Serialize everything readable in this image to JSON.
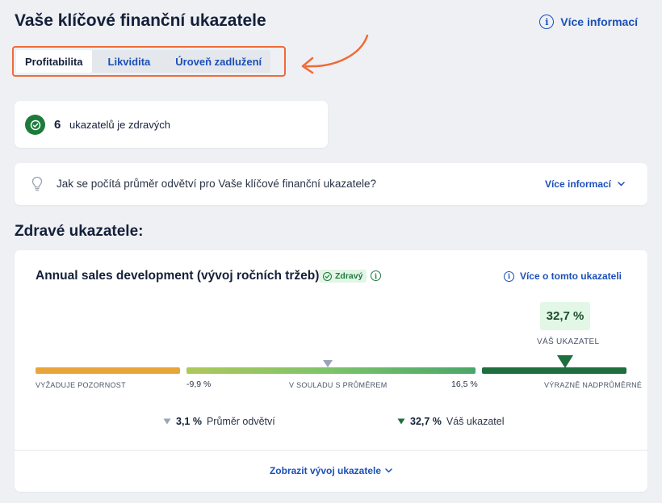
{
  "page_title": "Vaše klíčové finanční ukazatele",
  "more_info_top": "Více informací",
  "tabs": [
    {
      "label": "Profitabilita",
      "active": true
    },
    {
      "label": "Likvidita",
      "active": false
    },
    {
      "label": "Úroveň zadlužení",
      "active": false
    }
  ],
  "healthy": {
    "count": "6",
    "label": "ukazatelů je zdravých"
  },
  "faq": {
    "question": "Jak se počítá průměr odvětví pro Vaše klíčové finanční ukazatele?",
    "more_label": "Více informací"
  },
  "section_heading": "Zdravé ukazatele:",
  "indicator": {
    "title": "Annual sales development (vývoj ročních tržeb)",
    "badge": "Zdravý",
    "more_label": "Více o tomto ukazateli",
    "your_value": "32,7 %",
    "your_label": "VÁŠ UKAZATEL",
    "scale": {
      "attention_label": "VYŽADUJE POZORNOST",
      "low_value": "-9,9 %",
      "average_label": "V SOULADU S PRŮMĚREM",
      "high_value": "16,5 %",
      "above_label": "VÝRAZNĚ NADPRŮMĚRNÉ"
    },
    "legend": {
      "avg_value": "3,1 %",
      "avg_label": "Průměr odvětví",
      "you_value": "32,7 %",
      "you_label": "Váš ukazatel"
    },
    "show_dev_label": "Zobrazit vývoj ukazatele"
  },
  "colors": {
    "accent": "#1b4fb8",
    "highlight": "#f06a38",
    "healthy_green": "#1e7a3c",
    "attention_orange": "#e8a63a"
  }
}
